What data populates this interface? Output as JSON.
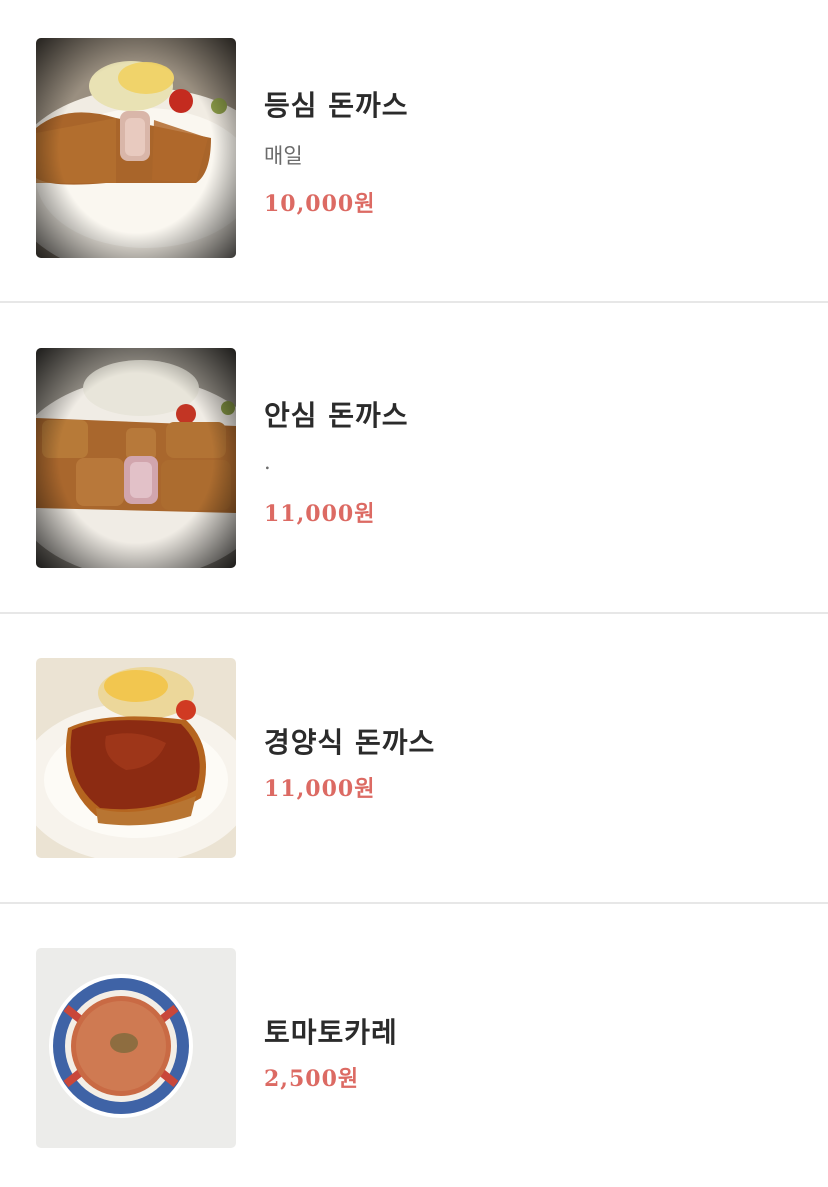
{
  "menu": {
    "items": [
      {
        "name": "등심 돈까스",
        "description": "매일",
        "price": "10,000원",
        "image": "pork-loin-cutlet-photo"
      },
      {
        "name": "안심 돈까스",
        "description": ".",
        "price": "11,000원",
        "image": "pork-tenderloin-cutlet-photo"
      },
      {
        "name": "경양식 돈까스",
        "price": "11,000원",
        "image": "western-style-cutlet-photo"
      },
      {
        "name": "토마토카레",
        "price": "2,500원",
        "image": "tomato-curry-photo"
      }
    ]
  },
  "colors": {
    "price": "#dc6a63",
    "title": "#2b2b2b",
    "description": "#6b6b6b",
    "divider": "#e7e7e7"
  }
}
